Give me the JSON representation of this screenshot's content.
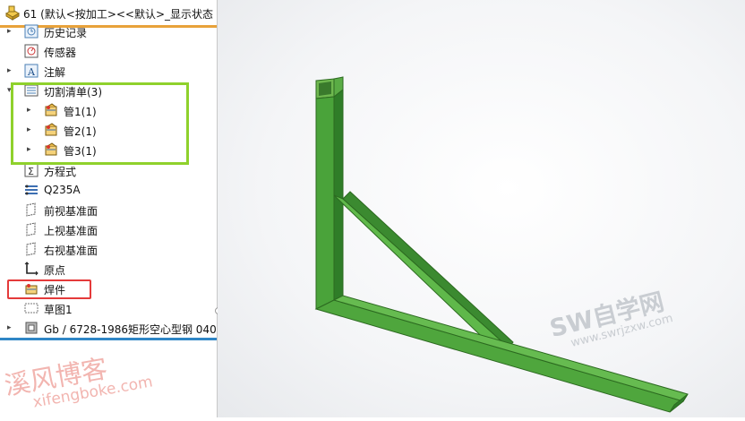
{
  "tree": {
    "header_title": "61  (默认<按加工><<默认>_显示状态",
    "items": [
      {
        "label": "历史记录",
        "arrow": "▸",
        "icon": "history-icon"
      },
      {
        "label": "传感器",
        "arrow": "",
        "icon": "sensor-icon"
      },
      {
        "label": "注解",
        "arrow": "▸",
        "icon": "annotation-icon"
      },
      {
        "label": "切割清单(3)",
        "arrow": "▾",
        "icon": "cutlist-icon"
      },
      {
        "label": "管1(1)",
        "arrow": "▸",
        "icon": "weldment-item-icon"
      },
      {
        "label": "管2(1)",
        "arrow": "▸",
        "icon": "weldment-item-icon"
      },
      {
        "label": "管3(1)",
        "arrow": "▸",
        "icon": "weldment-item-icon"
      },
      {
        "label": "方程式",
        "arrow": "",
        "icon": "equation-icon"
      },
      {
        "label": "Q235A",
        "arrow": "",
        "icon": "material-icon"
      },
      {
        "label": "前视基准面",
        "arrow": "",
        "icon": "plane-icon"
      },
      {
        "label": "上视基准面",
        "arrow": "",
        "icon": "plane-icon"
      },
      {
        "label": "右视基准面",
        "arrow": "",
        "icon": "plane-icon"
      },
      {
        "label": "原点",
        "arrow": "",
        "icon": "origin-icon"
      },
      {
        "label": "焊件",
        "arrow": "",
        "icon": "weldment-icon"
      },
      {
        "label": "草图1",
        "arrow": "",
        "icon": "sketch-icon"
      },
      {
        "label": "Gb / 6728-1986矩形空心型钢 040",
        "arrow": "▸",
        "icon": "structural-member-icon"
      }
    ]
  },
  "watermarks": {
    "sw_title": "SW自学网",
    "sw_url": "www.swrjzxw.com",
    "xf_title": "溪风博客",
    "xf_url": "xifengboke.com"
  },
  "colors": {
    "frame_green": "#3f9a2f",
    "highlight_green": "#8fd12c",
    "highlight_red": "#e43a3a",
    "header_orange": "#e8a23a",
    "divider_blue": "#2f86c6"
  }
}
